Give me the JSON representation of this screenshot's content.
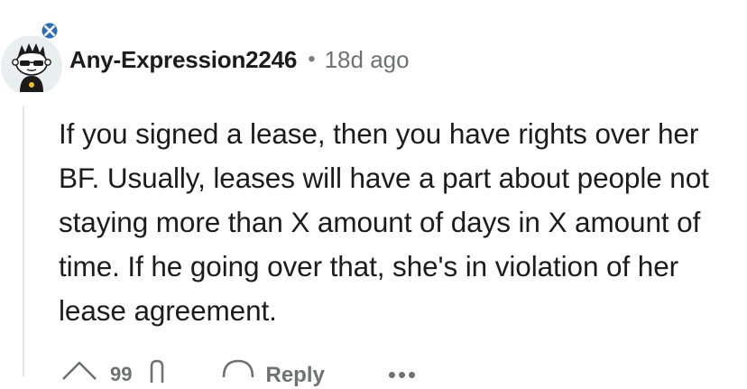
{
  "comment": {
    "author": "Any-Expression2246",
    "separator": "•",
    "timestamp": "18d ago",
    "body": "If you signed a lease, then you have rights over her BF. Usually, leases will have a part about people not staying more than X amount of days in X amount of time. If he going over that, she's in violation of her lease agreement.",
    "avatar_icon": "snoo-avatar-with-sunglasses",
    "flair_icon": "scottish-flag-icon"
  },
  "actions": {
    "upvote_icon": "upvote-arrow-icon",
    "vote_count": "99",
    "downvote_icon": "downvote-arrow-icon",
    "reply_label": "Reply",
    "more_label": "•••"
  },
  "colors": {
    "text": "#1c1c1c",
    "meta": "#6f7173",
    "thread_line": "#e0e4e6",
    "flag_blue": "#2a6fb8"
  }
}
